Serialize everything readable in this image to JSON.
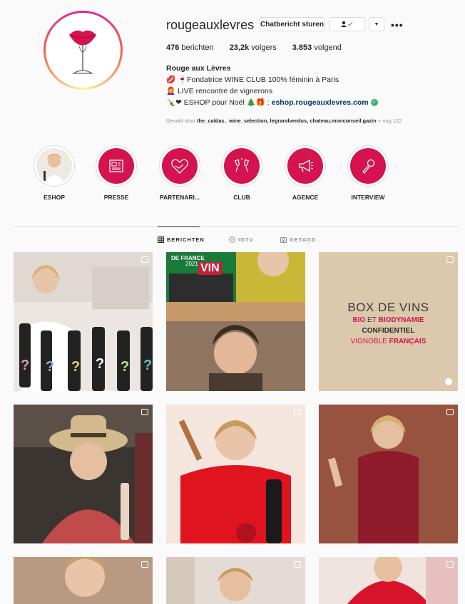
{
  "profile": {
    "username": "rougeauxlevres",
    "message_button": "Chatbericht sturen",
    "more": "•••",
    "stats": {
      "posts_count": "476",
      "posts_label": "berichten",
      "followers_count": "23,2k",
      "followers_label": "volgers",
      "following_count": "3.853",
      "following_label": "volgend"
    },
    "bio": {
      "name": "Rouge aux Lèvres",
      "line1": "💋 🍷Fondatrice WINE CLUB 100% féminin à Paris",
      "line2": "👩‍🦰 LIVE rencontre de vignerons",
      "line3": "🍾❤ ESHOP pour Noël 🎄🎁 :",
      "link": "eshop.rougeauxlevres.com",
      "followed_prefix": "Gevold door",
      "followed_names": "the_caldas_ wine_selection, legrandverdus, chateau.monconseil.gazin",
      "followed_suffix": "+ nog 122"
    }
  },
  "highlights": [
    {
      "label": "ESHOP",
      "icon": "woman-photo-icon"
    },
    {
      "label": "PRESSE",
      "icon": "newspaper-icon"
    },
    {
      "label": "PARTENARI...",
      "icon": "handshake-heart-icon"
    },
    {
      "label": "CLUB",
      "icon": "wine-glasses-icon"
    },
    {
      "label": "AGENCE",
      "icon": "megaphone-icon"
    },
    {
      "label": "INTERVIEW",
      "icon": "microphone-icon"
    }
  ],
  "tabs": [
    {
      "label": "BERICHTEN",
      "icon": "grid-icon",
      "active": true
    },
    {
      "label": "IGTV",
      "icon": "igtv-icon",
      "active": false
    },
    {
      "label": "GETAGD",
      "icon": "tag-icon",
      "active": false
    }
  ],
  "posts": {
    "p1_text": "?",
    "p2_top_a": "DE FRANCE",
    "p2_top_b": "2021",
    "p2_top_c": "VIN",
    "p3_title": "BOX DE VINS",
    "p3_line1a": "BIO",
    "p3_line1b": "ET",
    "p3_line1c": "BIODYNAMIE",
    "p3_line2": "CONFIDENTIEL",
    "p3_line3a": "VIGNOBLE",
    "p3_line3b": "FRANÇAIS"
  },
  "colors": {
    "highlight_red": "#d5134f",
    "link_blue": "#00376b"
  }
}
